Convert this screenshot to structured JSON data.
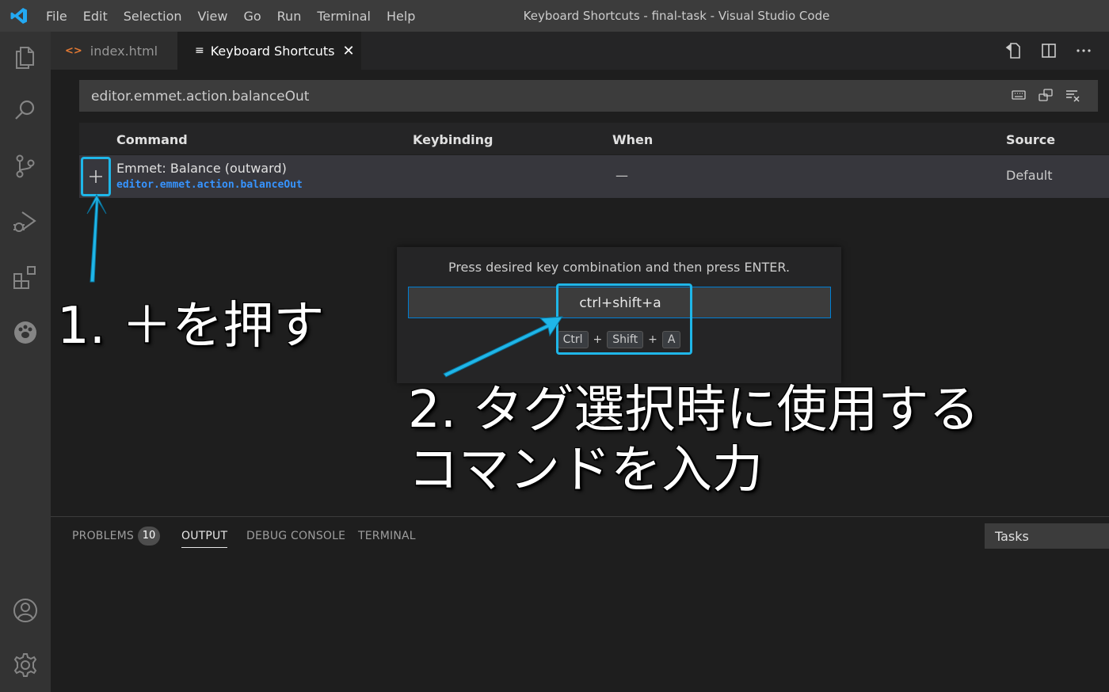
{
  "titlebar": {
    "menu": [
      "File",
      "Edit",
      "Selection",
      "View",
      "Go",
      "Run",
      "Terminal",
      "Help"
    ],
    "window_title": "Keyboard Shortcuts - final-task - Visual Studio Code"
  },
  "activity_bar": [
    "files-icon",
    "search-icon",
    "source-control-icon",
    "run-debug-icon",
    "extensions-icon",
    "paw-icon",
    "account-icon",
    "gear-icon"
  ],
  "tabs": [
    {
      "icon": "<>",
      "label": "index.html"
    },
    {
      "icon": "≡",
      "label": "Keyboard Shortcuts",
      "close": "✕"
    }
  ],
  "search": {
    "value": "editor.emmet.action.balanceOut"
  },
  "table": {
    "headers": [
      "Command",
      "Keybinding",
      "When",
      "Source"
    ],
    "row": {
      "add": "+",
      "title": "Emmet: Balance (outward)",
      "id": "editor.emmet.action.balanceOut",
      "when": "—",
      "source": "Default"
    }
  },
  "dialog": {
    "message": "Press desired key combination and then press ENTER.",
    "input_value": "ctrl+shift+a",
    "keys": [
      "Ctrl",
      "Shift",
      "A"
    ],
    "plus": "+"
  },
  "panel": {
    "tabs": [
      "PROBLEMS",
      "OUTPUT",
      "DEBUG CONSOLE",
      "TERMINAL"
    ],
    "problems_count": "10",
    "active": "OUTPUT",
    "task_select": "Tasks"
  },
  "annotations": {
    "step1": "1. ＋を押す",
    "step2_line1": "2. タグ選択時に使用する",
    "step2_line2": "コマンドを入力"
  },
  "colors": {
    "highlight": "#1fb6e8",
    "accent": "#007fd4",
    "command_id": "#3794ff"
  }
}
